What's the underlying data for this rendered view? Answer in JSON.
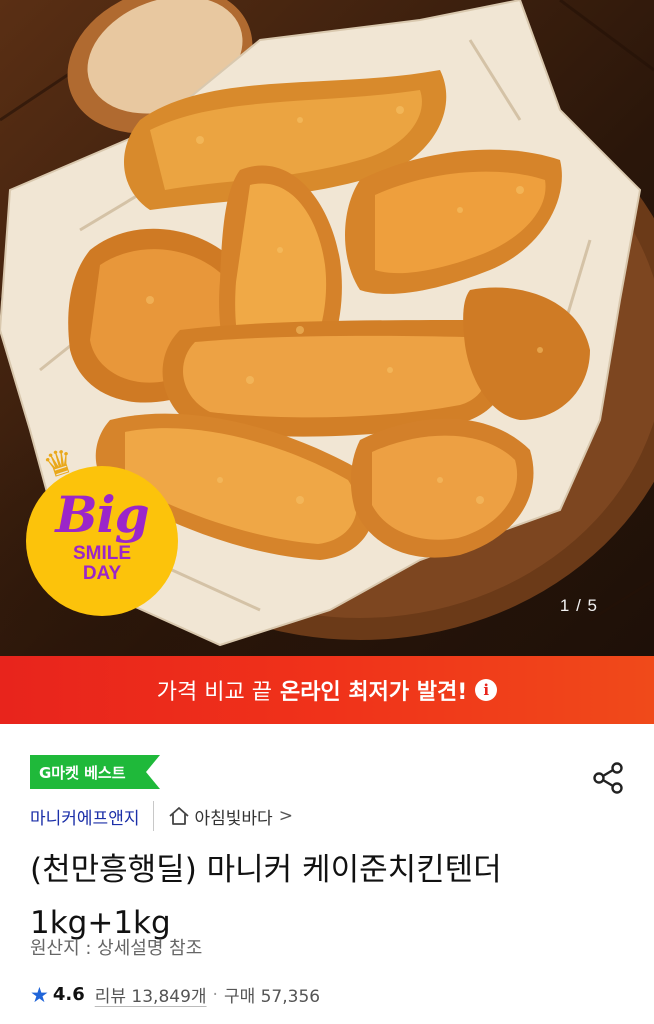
{
  "hero": {
    "badge": {
      "big": "Big",
      "line1": "SMILE",
      "line2": "DAY"
    },
    "counter": "1 / 5"
  },
  "promo": {
    "plain": "가격 비교 끝",
    "bold": "온라인 최저가 발견!",
    "info_icon": "info-icon"
  },
  "product": {
    "best_tag": "G마켓 베스트",
    "seller": "마니커에프앤지",
    "store": "아침빛바다",
    "store_chevron": ">",
    "title_line1": "(천만흥행딜) 마니커 케이준치킨텐더",
    "title_line2": "1kg+1kg",
    "origin": "원산지 : 상세설명 참조",
    "rating": "4.6",
    "reviews": "리뷰 13,849개",
    "separator": "·",
    "purchases": "구매 57,356"
  },
  "colors": {
    "promo_red": "#e8241c",
    "best_green": "#1fb93a",
    "seller_blue": "#1b2fa8",
    "star_blue": "#2065d9",
    "badge_yellow": "#fcc30b",
    "badge_purple": "#9b26c9"
  }
}
